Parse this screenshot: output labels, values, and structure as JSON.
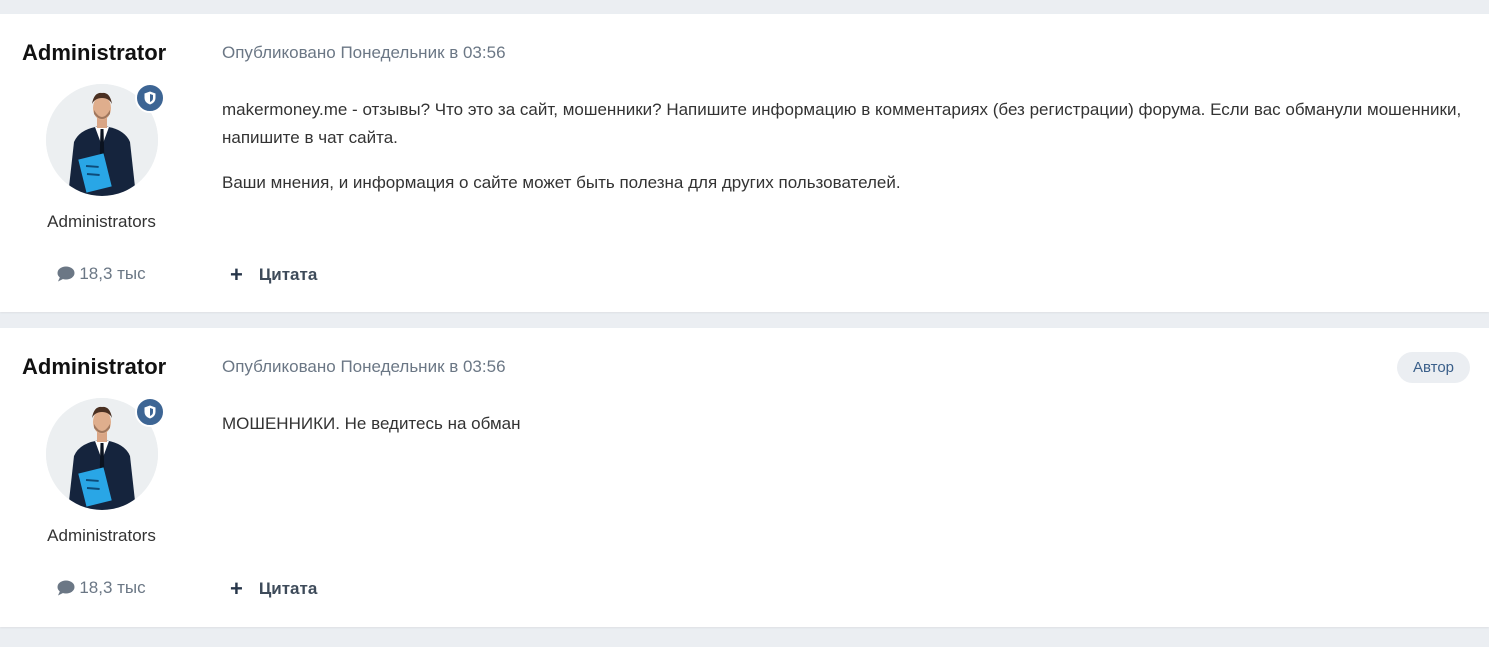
{
  "posts": [
    {
      "author": "Administrator",
      "group": "Administrators",
      "post_count": "18,3 тыс",
      "published": "Опубликовано Понедельник в 03:56",
      "author_badge": "",
      "paragraphs": [
        "makermoney.me - отзывы? Что это за сайт, мошенники? Напишите информацию в комментариях (без регистрации) форума. Если вас обманули мошенники, напишите в чат сайта.",
        "Ваши мнения, и информация о сайте может быть полезна для других пользователей."
      ],
      "quote_label": "Цитата"
    },
    {
      "author": "Administrator",
      "group": "Administrators",
      "post_count": "18,3 тыс",
      "published": "Опубликовано Понедельник в 03:56",
      "author_badge": "Автор",
      "paragraphs": [
        "МОШЕННИКИ. Не ведитесь на обман"
      ],
      "quote_label": "Цитата"
    }
  ],
  "icons": {
    "moderator": "shield-icon",
    "posts": "comment-icon",
    "quote": "plus-icon"
  },
  "colors": {
    "page_background": "#ebeef2",
    "accent": "#3d6594",
    "muted_text": "#6b7785"
  }
}
